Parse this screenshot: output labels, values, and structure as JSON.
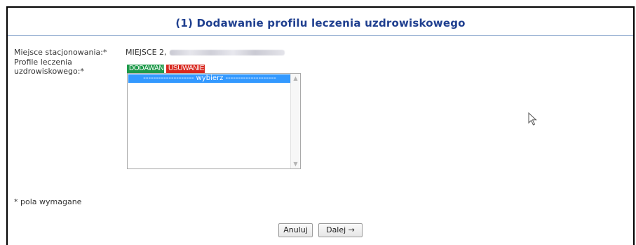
{
  "header": {
    "title": "(1) Dodawanie profilu leczenia uzdrowiskowego"
  },
  "form": {
    "location_label": "Miejsce stacjonowania:*",
    "location_value": "MIEJSCE 2,",
    "profiles_label_line1": "Profile leczenia",
    "profiles_label_line2": "uzdrowiskowego:*",
    "add_tag": "DODAWANIE",
    "remove_tag": "USUWANIE",
    "select_option": "-------------------- wybierz --------------------"
  },
  "footer": {
    "required_note": "* pola wymagane",
    "cancel_label": "Anuluj",
    "next_label": "Dalej →"
  },
  "colors": {
    "title": "#1f3f8f",
    "add_tag_bg": "#1e9a4a",
    "remove_tag_bg": "#d8281f",
    "selected_option_bg": "#3399ff"
  }
}
